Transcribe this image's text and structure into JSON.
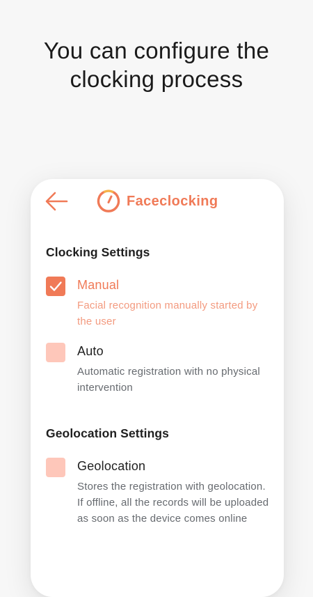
{
  "headline": {
    "line1": "You can configure the",
    "line2": "clocking process"
  },
  "appbar": {
    "back_icon": "arrow-left-icon",
    "logo_icon": "gauge-logo-icon",
    "brand_name": "Faceclocking"
  },
  "colors": {
    "accent": "#f07a57",
    "accent_light": "#fec7ba",
    "background": "#f7f7f7",
    "card": "#ffffff"
  },
  "clocking_settings": {
    "title": "Clocking Settings",
    "options": [
      {
        "label": "Manual",
        "description": "Facial recognition manually started by the user",
        "checked": true
      },
      {
        "label": "Auto",
        "description": "Automatic registration with no physical intervention",
        "checked": false
      }
    ]
  },
  "geolocation_settings": {
    "title": "Geolocation Settings",
    "options": [
      {
        "label": "Geolocation",
        "description": "Stores the registration with geolocation. If offline, all the records will be uploaded as soon as the device comes online",
        "checked": false
      }
    ]
  }
}
